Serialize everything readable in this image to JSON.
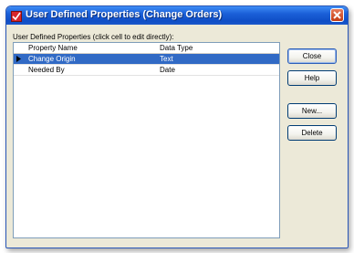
{
  "window": {
    "title": "User Defined Properties (Change Orders)"
  },
  "grid": {
    "group_label": "User Defined Properties (click cell to edit directly):",
    "columns": [
      "Property Name",
      "Data Type"
    ],
    "rows": [
      {
        "name": "Change Origin",
        "type": "Text",
        "selected": true
      },
      {
        "name": "Needed By",
        "type": "Date",
        "selected": false
      }
    ]
  },
  "buttons": {
    "close": "Close",
    "help": "Help",
    "new": "New...",
    "delete": "Delete"
  },
  "colors": {
    "titlebar": "#0f4ec6",
    "selection": "#316ac5",
    "dialog_bg": "#ece9d8"
  },
  "icons": {
    "app": "app-icon",
    "close": "close-icon",
    "row_pointer": "row-pointer-icon"
  }
}
